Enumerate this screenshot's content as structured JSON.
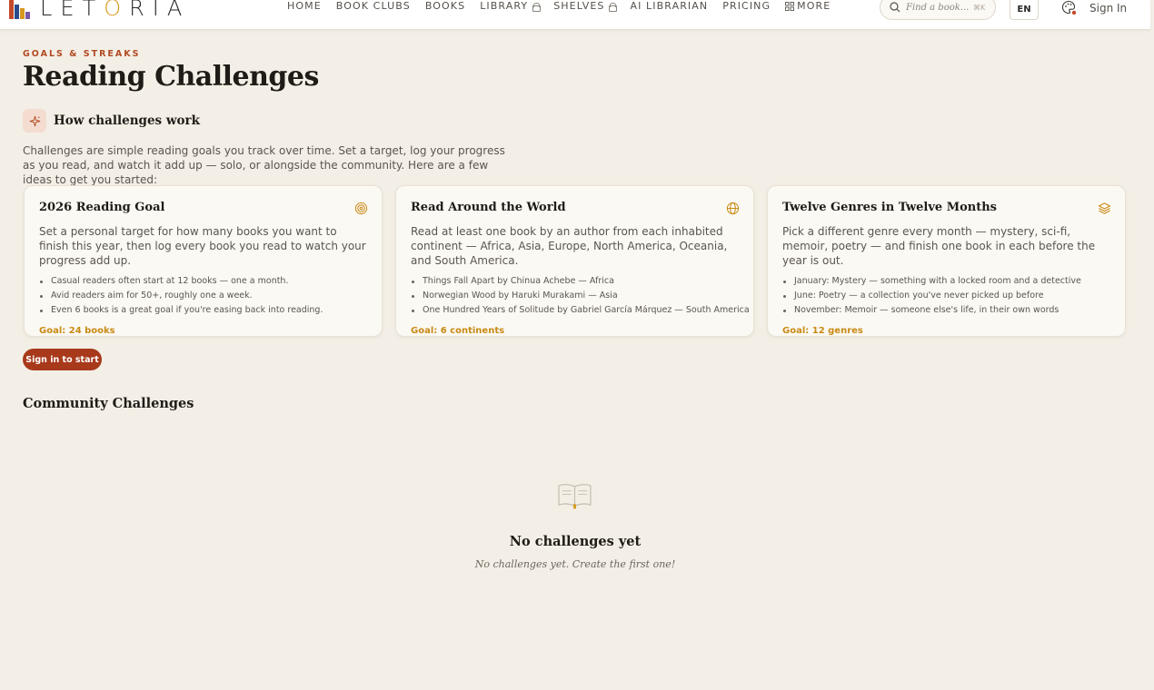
{
  "header": {
    "logo_left": "LET",
    "logo_o": "O",
    "logo_right": "RIA",
    "nav": [
      {
        "label": "HOME",
        "locked": false
      },
      {
        "label": "BOOK CLUBS",
        "locked": false
      },
      {
        "label": "BOOKS",
        "locked": false
      },
      {
        "label": "LIBRARY",
        "locked": true
      },
      {
        "label": "SHELVES",
        "locked": true
      },
      {
        "label": "AI LIBRARIAN",
        "locked": false
      },
      {
        "label": "PRICING",
        "locked": false
      },
      {
        "label": "MORE",
        "locked": false
      }
    ],
    "search_placeholder": "Find a book...",
    "search_shortcut": "⌘K",
    "language": "EN",
    "sign_in": "Sign In"
  },
  "page": {
    "eyebrow": "GOALS & STREAKS",
    "title": "Reading Challenges",
    "how_title": "How challenges work",
    "intro": "Challenges are simple reading goals you track over time. Set a target, log your progress as you read, and watch it add up — solo, or alongside the community. Here are a few ideas to get you started:"
  },
  "cards": [
    {
      "title": "2026 Reading Goal",
      "icon": "target-icon",
      "description": "Set a personal target for how many books you want to finish this year, then log every book you read to watch your progress add up.",
      "bullets": [
        "Casual readers often start at 12 books — one a month.",
        "Avid readers aim for 50+, roughly one a week.",
        "Even 6 books is a great goal if you're easing back into reading."
      ],
      "goal": "Goal: 24 books"
    },
    {
      "title": "Read Around the World",
      "icon": "globe-icon",
      "description": "Read at least one book by an author from each inhabited continent — Africa, Asia, Europe, North America, Oceania, and South America.",
      "bullets": [
        "Things Fall Apart by Chinua Achebe — Africa",
        "Norwegian Wood by Haruki Murakami — Asia",
        "One Hundred Years of Solitude by Gabriel García Márquez — South America"
      ],
      "goal": "Goal: 6 continents"
    },
    {
      "title": "Twelve Genres in Twelve Months",
      "icon": "layers-icon",
      "description": "Pick a different genre every month — mystery, sci-fi, memoir, poetry — and finish one book in each before the year is out.",
      "bullets": [
        "January: Mystery — something with a locked room and a detective",
        "June: Poetry — a collection you've never picked up before",
        "November: Memoir — someone else's life, in their own words"
      ],
      "goal": "Goal: 12 genres"
    }
  ],
  "start_button": "Sign in to start",
  "community": {
    "title": "Community Challenges",
    "empty_title": "No challenges yet",
    "empty_subtitle": "No challenges yet. Create the first one!"
  },
  "colors": {
    "accent": "#a8391b",
    "gold": "#c98a16",
    "background": "#f3efe6"
  }
}
